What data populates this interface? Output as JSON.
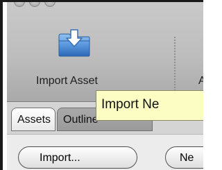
{
  "toolbar": {
    "import_asset_label": "Import Asset",
    "next_item_label": "A",
    "import_asset_icon": "folder-import-icon",
    "colors": {
      "folder_blue": "#4f8fd6",
      "arrow_white": "#ffffff"
    }
  },
  "tooltip": {
    "text": "Import Ne"
  },
  "tabs": [
    {
      "label": "Assets",
      "selected": true
    },
    {
      "label": "Outline",
      "selected": false
    }
  ],
  "buttons": {
    "import_label": "Import...",
    "new_label": "Ne"
  }
}
